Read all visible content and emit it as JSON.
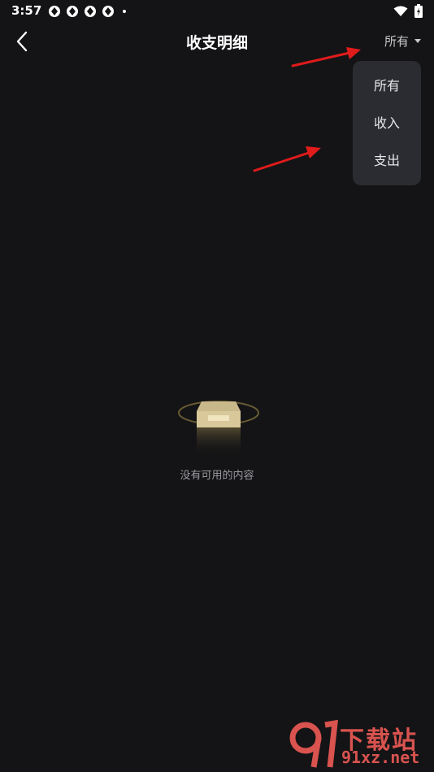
{
  "status_bar": {
    "time": "3:57",
    "notification_icons": [
      "aperture-icon",
      "aperture-icon",
      "aperture-icon",
      "aperture-icon"
    ],
    "system_icons": [
      "wifi-icon",
      "battery-icon"
    ]
  },
  "header": {
    "title": "收支明细",
    "filter_label": "所有"
  },
  "dropdown": {
    "items": [
      {
        "label": "所有"
      },
      {
        "label": "收入"
      },
      {
        "label": "支出"
      }
    ]
  },
  "empty_state": {
    "message": "没有可用的内容"
  },
  "watermark": {
    "top": "下载站",
    "bottom": "91xz.net"
  },
  "colors": {
    "background": "#141416",
    "dropdown_bg": "#2b2c31",
    "annotation_arrow": "#e01b1b",
    "watermark": "#d9534f"
  }
}
